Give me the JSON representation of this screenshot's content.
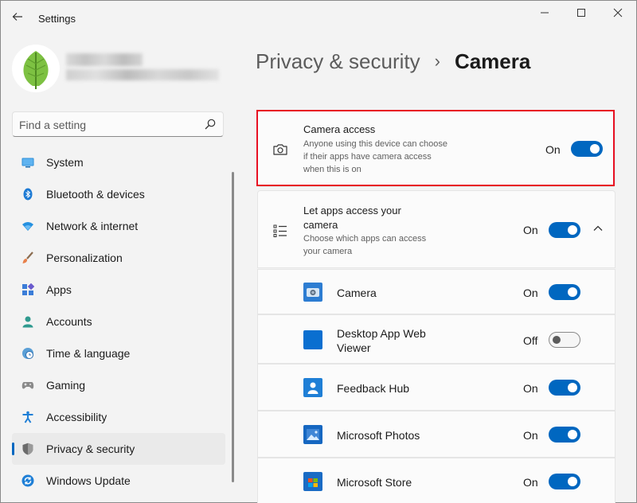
{
  "window": {
    "title": "Settings",
    "back_icon": "arrow-left-icon",
    "minimize_icon": "minimize-icon",
    "maximize_icon": "maximize-icon",
    "close_icon": "close-icon"
  },
  "profile": {
    "avatar_icon": "leaf-icon"
  },
  "search": {
    "placeholder": "Find a setting",
    "value": ""
  },
  "sidebar": {
    "items": [
      {
        "label": "System",
        "icon": "monitor-icon"
      },
      {
        "label": "Bluetooth & devices",
        "icon": "bluetooth-icon"
      },
      {
        "label": "Network & internet",
        "icon": "wifi-icon"
      },
      {
        "label": "Personalization",
        "icon": "brush-icon"
      },
      {
        "label": "Apps",
        "icon": "apps-icon"
      },
      {
        "label": "Accounts",
        "icon": "person-icon"
      },
      {
        "label": "Time & language",
        "icon": "clock-globe-icon"
      },
      {
        "label": "Gaming",
        "icon": "gamepad-icon"
      },
      {
        "label": "Accessibility",
        "icon": "accessibility-icon"
      },
      {
        "label": "Privacy & security",
        "icon": "shield-icon",
        "selected": true
      },
      {
        "label": "Windows Update",
        "icon": "update-icon"
      }
    ]
  },
  "header": {
    "parent": "Privacy & security",
    "separator": "›",
    "current": "Camera"
  },
  "camera_access": {
    "title": "Camera access",
    "description_lines": [
      "Anyone using this device can choose",
      "if their apps have camera access",
      "when this is on"
    ],
    "state": "On",
    "enabled": true,
    "icon": "camera-icon"
  },
  "apps_access": {
    "title_lines": [
      "Let apps access your",
      "camera"
    ],
    "description_lines": [
      "Choose which apps can access",
      "your camera"
    ],
    "state": "On",
    "enabled": true,
    "icon": "list-icon",
    "expand_icon": "chevron-up-icon"
  },
  "apps": [
    {
      "name_lines": [
        "Camera"
      ],
      "state": "On",
      "enabled": true,
      "icon": "camera-app-icon"
    },
    {
      "name_lines": [
        "Desktop App Web",
        "Viewer"
      ],
      "state": "Off",
      "enabled": false,
      "icon": "desktop-web-viewer-icon"
    },
    {
      "name_lines": [
        "Feedback Hub"
      ],
      "state": "On",
      "enabled": true,
      "icon": "feedback-hub-icon"
    },
    {
      "name_lines": [
        "Microsoft Photos"
      ],
      "state": "On",
      "enabled": true,
      "icon": "photos-icon"
    },
    {
      "name_lines": [
        "Microsoft Store"
      ],
      "state": "On",
      "enabled": true,
      "icon": "store-icon"
    }
  ],
  "colors": {
    "accent": "#0067c0",
    "highlight_border": "#e81123",
    "background": "#f3f3f3",
    "card": "#fbfbfb"
  }
}
